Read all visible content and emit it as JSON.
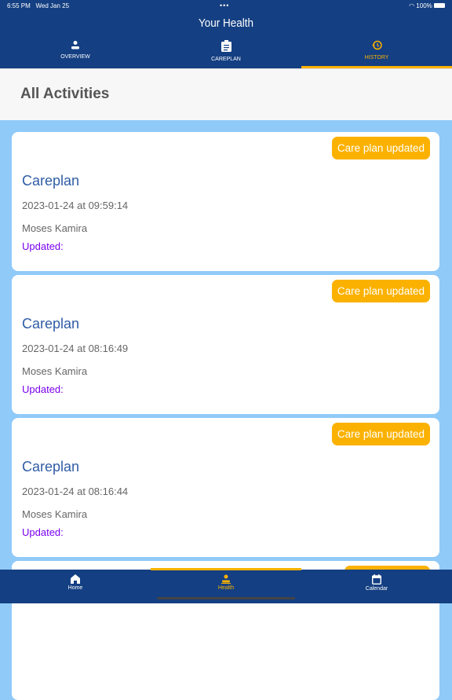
{
  "status": {
    "time": "6:55 PM",
    "date": "Wed Jan 25",
    "battery": "100%"
  },
  "header": {
    "title": "Your Health"
  },
  "tabs": [
    {
      "label": "OVERVIEW",
      "icon": "person-icon"
    },
    {
      "label": "CAREPLAN",
      "icon": "clipboard-icon"
    },
    {
      "label": "HISTORY",
      "icon": "history-icon",
      "active": true
    }
  ],
  "page": {
    "heading": "All Activities"
  },
  "activities": [
    {
      "badge": "Care plan updated",
      "title": "Careplan",
      "datetime": "2023-01-24 at 09:59:14",
      "user": "Moses Kamira",
      "detail": "Updated:"
    },
    {
      "badge": "Care plan updated",
      "title": "Careplan",
      "datetime": "2023-01-24 at 08:16:49",
      "user": "Moses Kamira",
      "detail": "Updated:"
    },
    {
      "badge": "Care plan updated",
      "title": "Careplan",
      "datetime": "2023-01-24 at 08:16:44",
      "user": "Moses Kamira",
      "detail": "Updated:"
    }
  ],
  "bottom_nav": [
    {
      "label": "Home",
      "icon": "home-icon"
    },
    {
      "label": "Health",
      "icon": "person-icon",
      "active": true
    },
    {
      "label": "Calendar",
      "icon": "calendar-icon"
    }
  ],
  "colors": {
    "primary": "#143f82",
    "accent": "#fbb100",
    "background": "#90caf9",
    "title": "#2f5ca5",
    "updated": "#7a00ef"
  }
}
